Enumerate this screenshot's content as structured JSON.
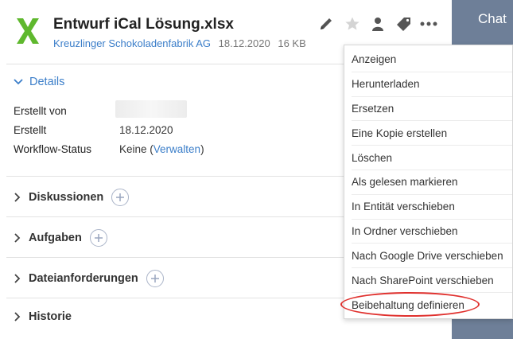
{
  "chat": {
    "label": "Chat"
  },
  "file": {
    "icon": "excel-x-icon",
    "name": "Entwurf iCal Lösung.xlsx",
    "entity": "Kreuzlinger Schokoladenfabrik AG",
    "date": "18.12.2020",
    "size": "16 KB"
  },
  "toolbar": {
    "icons": [
      "pencil-icon",
      "star-icon",
      "user-icon",
      "tag-icon",
      "more-icon"
    ]
  },
  "details": {
    "header": "Details",
    "rows": [
      {
        "label": "Erstellt von",
        "value": ""
      },
      {
        "label": "Erstellt",
        "value": "18.12.2020"
      },
      {
        "label": "Workflow-Status",
        "value": "Keine",
        "link": "Verwalten"
      }
    ]
  },
  "sections": [
    {
      "label": "Diskussionen",
      "has_add": true
    },
    {
      "label": "Aufgaben",
      "has_add": true
    },
    {
      "label": "Dateianforderungen",
      "has_add": true
    },
    {
      "label": "Historie",
      "has_add": false
    }
  ],
  "menu": {
    "items": [
      "Anzeigen",
      "Herunterladen",
      "Ersetzen",
      "Eine Kopie erstellen",
      "Löschen",
      "Als gelesen markieren",
      "In Entität verschieben",
      "In Ordner verschieben",
      "Nach Google Drive verschieben",
      "Nach SharePoint verschieben",
      "Beibehaltung definieren"
    ],
    "highlighted": "Beibehaltung definieren"
  },
  "colors": {
    "accent": "#3b7ec9",
    "excel_green": "#5fb82e",
    "highlight_red": "#e0312e",
    "chat_panel": "#6e7f98"
  }
}
